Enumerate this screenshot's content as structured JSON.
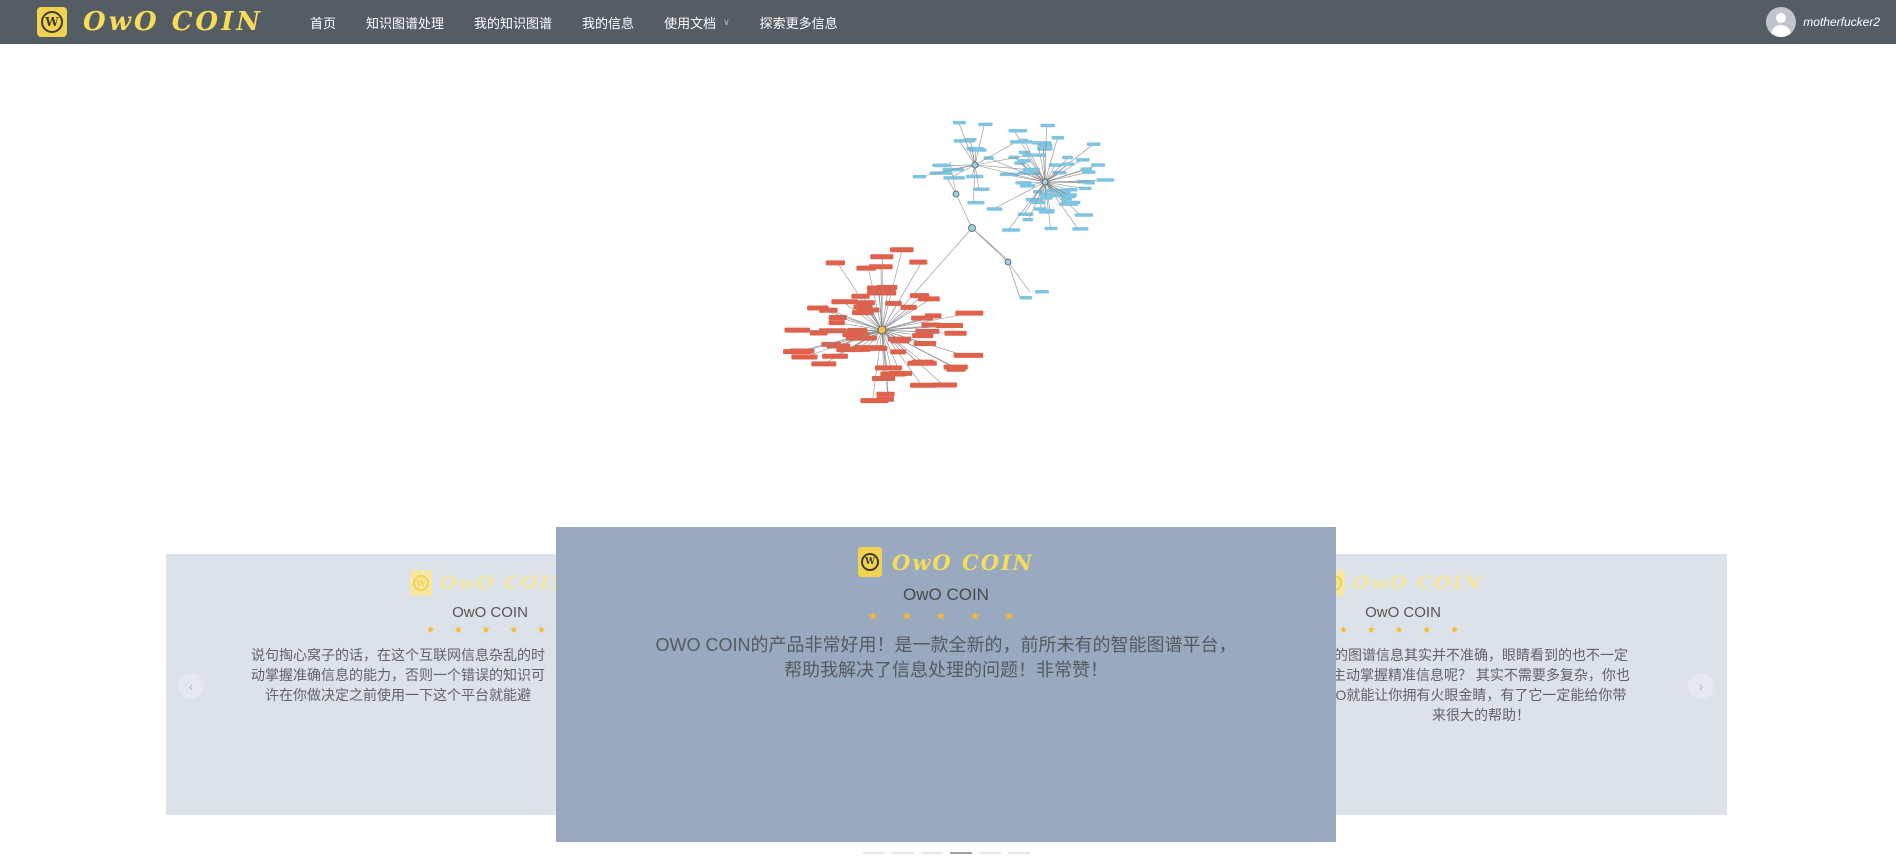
{
  "brand": {
    "logo_letter": "W",
    "name": "OwO COIN"
  },
  "nav": {
    "items": [
      {
        "label": "首页"
      },
      {
        "label": "知识图谱处理"
      },
      {
        "label": "我的知识图谱"
      },
      {
        "label": "我的信息"
      },
      {
        "label": "使用文档",
        "has_dropdown": true
      },
      {
        "label": "探索更多信息"
      }
    ]
  },
  "user": {
    "username": "motherfucker2"
  },
  "carousel": {
    "slides": [
      {
        "brand": "OwO COIN",
        "name": "OwO COIN",
        "stars": "★ ★ ★ ★ ★",
        "text_lines": [
          "说句掏心窝子的话，在这个互联网信息杂乱的时",
          "动掌握准确信息的能力，否则一个错误的知识可",
          "许在你做决定之前使用一下这个平台就能避"
        ]
      },
      {
        "brand": "OwO COIN",
        "name": "OwO COIN",
        "stars": "★ ★ ★ ★ ★",
        "text_lines": [
          "OWO COIN的产品非常好用！是一款全新的，前所未有的智能图谱平台，",
          "帮助我解决了信息处理的问题！非常赞！"
        ]
      },
      {
        "brand": "OwO COIN",
        "name": "OwO COIN",
        "stars": "★ ★ ★ ★ ★",
        "text_lines": [
          "的图谱信息其实并不准确，眼睛看到的也不一定",
          "主动掌握精准信息呢？ 其实不需要多复杂，你也",
          "O就能让你拥有火眼金睛，有了它一定能给你带",
          "来很大的帮助！"
        ]
      }
    ],
    "prev_icon": "chevron-left-icon",
    "next_icon": "chevron-right-icon",
    "indicator_count": 6,
    "active_indicator": 4
  },
  "colors": {
    "navbar": "#545c64",
    "brand_yellow": "#f2d34f",
    "carousel_bg": "#dce2ea",
    "active_card": "#99a9bf",
    "star": "#f7ba2a",
    "graph_red": "#e0614b",
    "graph_blue": "#7fc4e0"
  }
}
